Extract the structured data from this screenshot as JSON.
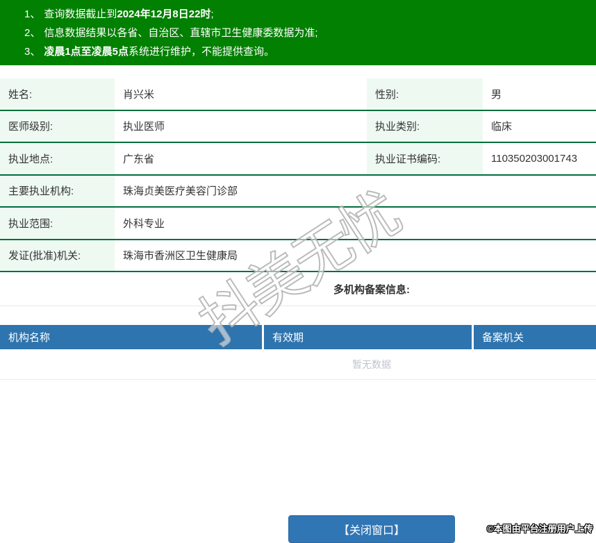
{
  "notices": {
    "items": [
      {
        "num": "1、",
        "pre": "查询数据截止到",
        "bold": "2024年12月8日22时",
        "post": ";"
      },
      {
        "num": "2、",
        "pre": "信息数据结果以各省、自治区、直辖市卫生健康委数据为准;",
        "bold": "",
        "post": ""
      },
      {
        "num": "3、",
        "pre": "",
        "bold": "凌晨1点至凌晨5点",
        "post": "系统进行维护，不能提供查询。"
      }
    ]
  },
  "info": {
    "name": {
      "label": "姓名:",
      "value": "肖兴米"
    },
    "gender": {
      "label": "性别:",
      "value": "男"
    },
    "doctor_level": {
      "label": "医师级别:",
      "value": "执业医师"
    },
    "practice_type": {
      "label": "执业类别:",
      "value": "临床"
    },
    "practice_place": {
      "label": "执业地点:",
      "value": "广东省"
    },
    "cert_code": {
      "label": "执业证书编码:",
      "value": "110350203001743"
    },
    "main_org": {
      "label": "主要执业机构:",
      "value": "珠海贞美医疗美容门诊部"
    },
    "scope": {
      "label": "执业范围:",
      "value": "外科专业"
    },
    "issuer": {
      "label": "发证(批准)机关:",
      "value": "珠海市香洲区卫生健康局"
    }
  },
  "filing_section": {
    "title": "多机构备案信息:",
    "headers": [
      "机构名称",
      "有效期",
      "备案机关"
    ],
    "empty_text": "暂无数据"
  },
  "footer": {
    "close_button_label": "【关闭窗口】",
    "stamp_text": "©本图由平台注册用户上传"
  },
  "watermark": {
    "text": "抖美无忧"
  },
  "colors": {
    "notice_green": "#018001",
    "row_border_green": "#006e3c",
    "label_bg_mint": "#eef9f2",
    "table_header_blue": "#2e74ae",
    "button_blue": "#3176b4",
    "empty_text_gray": "#c0c4cc"
  }
}
